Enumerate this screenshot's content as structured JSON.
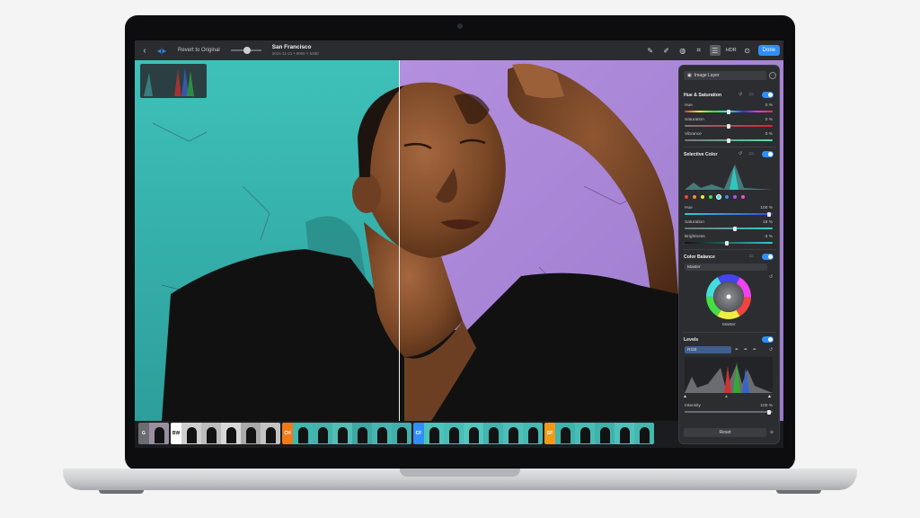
{
  "toolbar": {
    "back_icon": "chevron-left-icon",
    "revert_label": "Revert to Original",
    "doc_title": "San Francisco",
    "doc_meta": "2021-11-21 • 8060 × 5480",
    "hdr_label": "HDR",
    "done_label": "Done"
  },
  "filmstrip": {
    "groups": [
      {
        "tag": "G",
        "color": "#6b6b72"
      },
      {
        "tag": "BW",
        "color": "#ffffff"
      },
      {
        "tag": "CH",
        "color": "#f07a18"
      },
      {
        "tag": "CF",
        "color": "#2f8ff7"
      },
      {
        "tag": "SF",
        "color": "#f09a18"
      }
    ]
  },
  "panel": {
    "layer_label": "Image Layer",
    "hue_saturation": {
      "title": "Hue & Saturation",
      "rows": [
        {
          "label": "Hue",
          "value": "0 %"
        },
        {
          "label": "Saturation",
          "value": "0 %"
        },
        {
          "label": "Vibrance",
          "value": "0 %"
        }
      ]
    },
    "selective_color": {
      "title": "Selective Color",
      "rows": [
        {
          "label": "Hue",
          "value": "100 %"
        },
        {
          "label": "Saturation",
          "value": "15 %"
        },
        {
          "label": "Brightness",
          "value": "-3 %"
        }
      ]
    },
    "color_balance": {
      "title": "Color Balance",
      "mode": "Master",
      "wheel_label": "Master"
    },
    "levels": {
      "title": "Levels",
      "channel": "RGB",
      "intensity_label": "Intensity",
      "intensity_value": "100 %"
    },
    "reset_label": "Reset"
  },
  "colors": {
    "accent": "#2f8ff7",
    "teal_wall": "#3fb8b0",
    "purple_wall": "#a987d6"
  }
}
